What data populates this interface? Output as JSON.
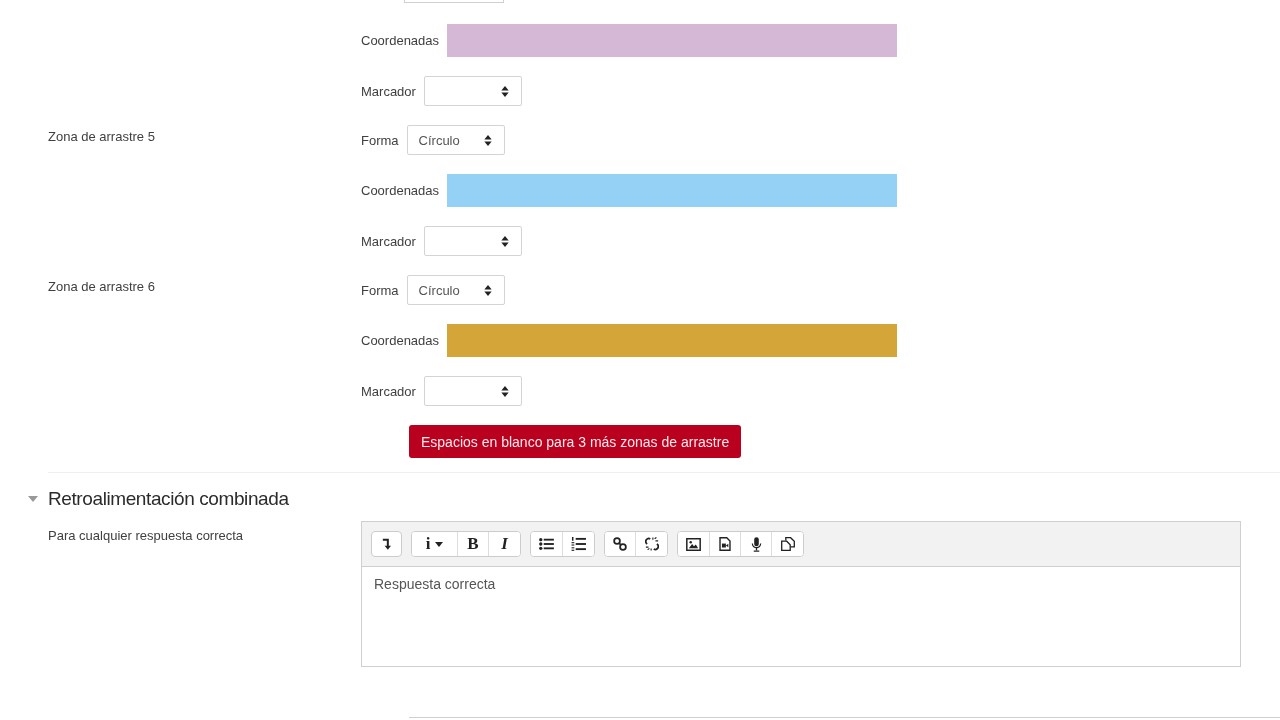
{
  "drop_zones": [
    {
      "fields": [
        {
          "kind": "clipped_select"
        },
        {
          "kind": "coordinates",
          "label": "Coordenadas",
          "color": "#d5b8d6"
        },
        {
          "kind": "select",
          "label": "Marcador"
        }
      ]
    },
    {
      "title": "Zona de arrastre 5",
      "fields": [
        {
          "kind": "select",
          "label": "Forma",
          "value": "Círculo"
        },
        {
          "kind": "coordinates",
          "label": "Coordenadas",
          "color": "#94d1f4"
        },
        {
          "kind": "select",
          "label": "Marcador"
        }
      ]
    },
    {
      "title": "Zona de arrastre 6",
      "fields": [
        {
          "kind": "select",
          "label": "Forma",
          "value": "Círculo"
        },
        {
          "kind": "coordinates",
          "label": "Coordenadas",
          "color": "#d4a538"
        },
        {
          "kind": "select",
          "label": "Marcador"
        }
      ]
    }
  ],
  "add_button": {
    "label": "Espacios en blanco para 3 más zonas de arrastre"
  },
  "feedback_section": {
    "title": "Retroalimentación combinada",
    "expanded": true,
    "fields": [
      {
        "label": "Para cualquier respuesta correcta",
        "editor": {
          "toolbar": [
            [
              {
                "kind": "toggle"
              }
            ],
            [
              {
                "kind": "styles",
                "glyph": "i"
              },
              {
                "kind": "bold",
                "glyph": "B"
              },
              {
                "kind": "italic",
                "glyph": "I"
              }
            ],
            [
              {
                "kind": "bullet_list"
              },
              {
                "kind": "numbered_list"
              }
            ],
            [
              {
                "kind": "link"
              },
              {
                "kind": "unlink"
              }
            ],
            [
              {
                "kind": "image"
              },
              {
                "kind": "media"
              },
              {
                "kind": "record_audio"
              },
              {
                "kind": "files"
              }
            ]
          ],
          "value": "Respuesta correcta"
        }
      }
    ]
  }
}
